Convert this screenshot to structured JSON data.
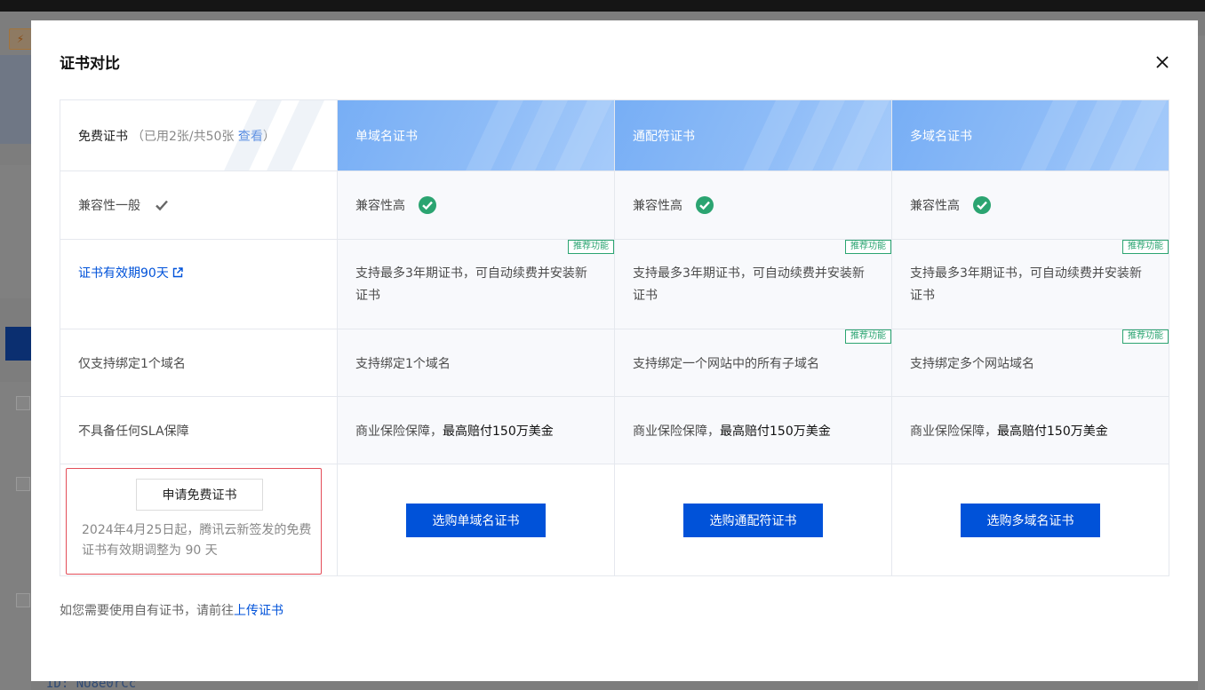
{
  "background": {
    "id_text": "ID: NU8e0rCc"
  },
  "modal": {
    "title": "证书对比",
    "close_icon": "close-icon",
    "header": {
      "free": {
        "title": "免费证书",
        "usage_prefix": "（已用2张/共50张 ",
        "view_link": "查看",
        "usage_suffix": "）"
      },
      "single": "单域名证书",
      "wildcard": "通配符证书",
      "multi": "多域名证书"
    },
    "rows": {
      "compatibility": {
        "free": "兼容性一般",
        "single": "兼容性高",
        "wildcard": "兼容性高",
        "multi": "兼容性高"
      },
      "validity": {
        "free_link": "证书有效期90天",
        "single": "支持最多3年期证书，可自动续费并安装新证书",
        "wildcard": "支持最多3年期证书，可自动续费并安装新证书",
        "multi": "支持最多3年期证书，可自动续费并安装新证书",
        "tag": "推荐功能"
      },
      "domain": {
        "free": "仅支持绑定1个域名",
        "single": "支持绑定1个域名",
        "wildcard": "支持绑定一个网站中的所有子域名",
        "multi": "支持绑定多个网站域名",
        "tag": "推荐功能"
      },
      "sla": {
        "free": "不具备任何SLA保障",
        "paid_prefix": "商业保险保障，",
        "paid_strong": "最高赔付150万美金"
      }
    },
    "actions": {
      "apply_free": "申请免费证书",
      "free_note": "2024年4月25日起，腾讯云新签发的免费证书有效期调整为 90 天",
      "buy_single": "选购单域名证书",
      "buy_wildcard": "选购通配符证书",
      "buy_multi": "选购多域名证书"
    },
    "footer": {
      "prefix": "如您需要使用自有证书，请前往",
      "link": "上传证书"
    }
  },
  "colors": {
    "primary": "#0052d9",
    "success": "#2ba471",
    "danger": "#e34d59",
    "header_gradient": "#77aef5"
  }
}
